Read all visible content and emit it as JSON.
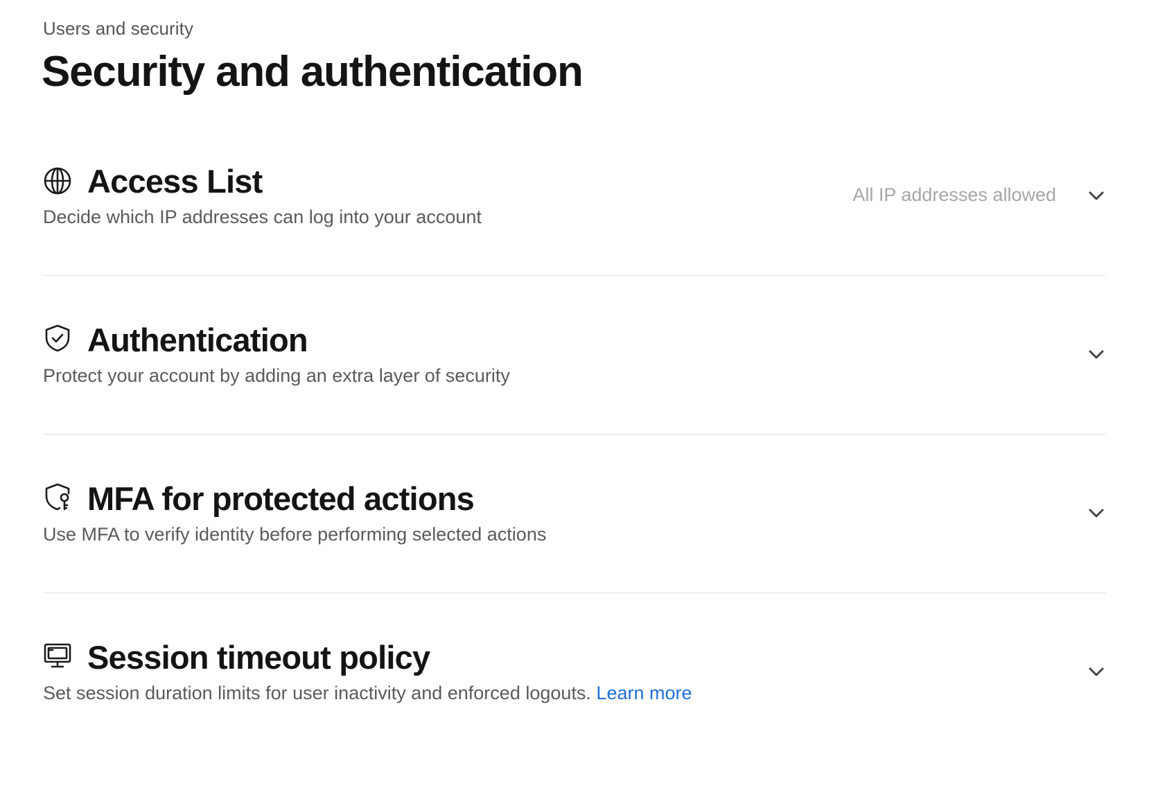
{
  "header": {
    "breadcrumb": "Users and security",
    "title": "Security and authentication"
  },
  "sections": [
    {
      "id": "access-list",
      "icon": "globe-icon",
      "title": "Access List",
      "description": "Decide which IP addresses can log into your account",
      "status": "All IP addresses allowed"
    },
    {
      "id": "authentication",
      "icon": "shield-check-icon",
      "title": "Authentication",
      "description": "Protect your account by adding an extra layer of security",
      "status": ""
    },
    {
      "id": "mfa",
      "icon": "shield-key-icon",
      "title": "MFA for protected actions",
      "description": "Use MFA to verify identity before performing selected actions",
      "status": ""
    },
    {
      "id": "session-timeout",
      "icon": "monitor-icon",
      "title": "Session timeout policy",
      "description": "Set session duration limits for user inactivity and enforced logouts.",
      "link": "Learn more",
      "status": ""
    }
  ],
  "colors": {
    "link": "#1f6fd6",
    "title": "#141414",
    "description": "#5a5a5a",
    "status": "#a6a6a6",
    "divider": "#e3e3e3"
  }
}
